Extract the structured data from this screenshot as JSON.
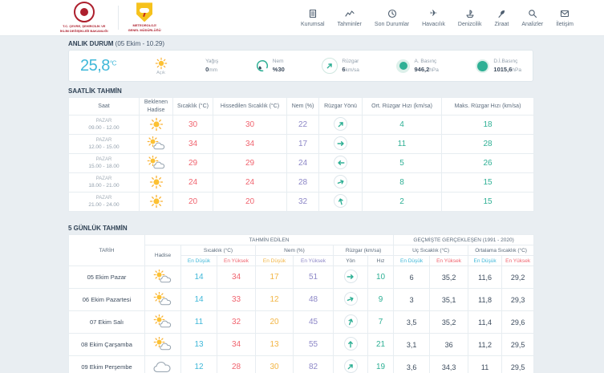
{
  "brand": {
    "ministry_caption_line1": "T.C. ÇEVRE, ŞEHİRCİLİK VE",
    "ministry_caption_line2": "İKLİM DEĞİŞİKLİĞİ BAKANLIĞI",
    "mgm_caption_line1": "METEOROLOJİ",
    "mgm_caption_line2": "GENEL MÜDÜRLÜĞÜ"
  },
  "nav": {
    "items": [
      {
        "label": "Kurumsal",
        "icon": "building"
      },
      {
        "label": "Tahminler",
        "icon": "chart"
      },
      {
        "label": "Son Durumlar",
        "icon": "clock"
      },
      {
        "label": "Havacılık",
        "icon": "plane"
      },
      {
        "label": "Denizcilik",
        "icon": "ship"
      },
      {
        "label": "Ziraat",
        "icon": "leaf"
      },
      {
        "label": "Analizler",
        "icon": "magnifier"
      },
      {
        "label": "İletişim",
        "icon": "mail"
      }
    ]
  },
  "current": {
    "section_title": "ANLIK DURUM",
    "section_time": "(05 Ekim - 10.29)",
    "temperature": "25,8",
    "temperature_unit": "°C",
    "condition": "Açık",
    "condition_icon": "sun",
    "precip_label": "Yağış",
    "precip_value": "0",
    "precip_unit": "mm",
    "humidity_label": "Nem",
    "humidity_value": "%30",
    "wind_label": "Rüzgar",
    "wind_value": "6",
    "wind_unit": "km/sa",
    "wind_dir": "NE",
    "pressure_label": "A. Basınç",
    "pressure_value": "946,2",
    "pressure_unit": "hPa",
    "sea_pressure_label": "D.İ.Basınç",
    "sea_pressure_value": "1015,6",
    "sea_pressure_unit": "hPa"
  },
  "hourly": {
    "section_title": "SAATLİK TAHMİN",
    "columns": [
      "Saat",
      "Beklenen Hadise",
      "Sıcaklık (°C)",
      "Hissedilen Sıcaklık (°C)",
      "Nem (%)",
      "Rüzgar Yönü",
      "Ort. Rüzgar Hızı (km/sa)",
      "Maks. Rüzgar Hızı (km/sa)"
    ],
    "rows": [
      {
        "day": "PAZAR",
        "time": "09.00 - 12.00",
        "icon": "sun",
        "temp": "30",
        "feels": "30",
        "humidity": "22",
        "dir": "NE",
        "avg_wind": "4",
        "max_wind": "18"
      },
      {
        "day": "PAZAR",
        "time": "12.00 - 15.00",
        "icon": "sun-cloud",
        "temp": "34",
        "feels": "34",
        "humidity": "17",
        "dir": "E",
        "avg_wind": "11",
        "max_wind": "28"
      },
      {
        "day": "PAZAR",
        "time": "15.00 - 18.00",
        "icon": "sun-cloud",
        "temp": "29",
        "feels": "29",
        "humidity": "24",
        "dir": "W",
        "avg_wind": "5",
        "max_wind": "26"
      },
      {
        "day": "PAZAR",
        "time": "18.00 - 21.00",
        "icon": "sun",
        "temp": "24",
        "feels": "24",
        "humidity": "28",
        "dir": "ENE",
        "avg_wind": "8",
        "max_wind": "15"
      },
      {
        "day": "PAZAR",
        "time": "21.00 - 24.00",
        "icon": "sun",
        "temp": "20",
        "feels": "20",
        "humidity": "32",
        "dir": "NNW",
        "avg_wind": "2",
        "max_wind": "15"
      }
    ]
  },
  "daily": {
    "section_title": "5 GÜNLÜK TAHMİN",
    "header": {
      "date": "TARİH",
      "predicted": "TAHMİN EDİLEN",
      "historical": "GEÇMİŞTE GERÇEKLEŞEN (1991 - 2020)",
      "hadise": "Hadise",
      "temp_group": "Sıcaklık (°C)",
      "hum_group": "Nem (%)",
      "wind_group": "Rüzgar (km/sa)",
      "extreme_group": "Uç Sıcaklık (°C)",
      "avg_group": "Ortalama Sıcaklık (°C)",
      "min": "En Düşük",
      "max": "En Yüksek",
      "dir": "Yön",
      "speed": "Hız"
    },
    "rows": [
      {
        "date": "05 Ekim Pazar",
        "icon": "sun-cloud",
        "tmin": "14",
        "tmax": "34",
        "hmin": "17",
        "hmax": "51",
        "dir": "E",
        "speed": "10",
        "ex_min": "6",
        "ex_max": "35,2",
        "avg_min": "11,6",
        "avg_max": "29,2"
      },
      {
        "date": "06 Ekim Pazartesi",
        "icon": "sun-cloud",
        "tmin": "14",
        "tmax": "33",
        "hmin": "12",
        "hmax": "48",
        "dir": "ENE",
        "speed": "9",
        "ex_min": "3",
        "ex_max": "35,1",
        "avg_min": "11,8",
        "avg_max": "29,3"
      },
      {
        "date": "07 Ekim Salı",
        "icon": "sun-cloud",
        "tmin": "11",
        "tmax": "32",
        "hmin": "20",
        "hmax": "45",
        "dir": "NNE",
        "speed": "7",
        "ex_min": "3,5",
        "ex_max": "35,2",
        "avg_min": "11,4",
        "avg_max": "29,6"
      },
      {
        "date": "08 Ekim Çarşamba",
        "icon": "sun-cloud",
        "tmin": "13",
        "tmax": "34",
        "hmin": "13",
        "hmax": "55",
        "dir": "N",
        "speed": "21",
        "ex_min": "3,1",
        "ex_max": "36",
        "avg_min": "11,2",
        "avg_max": "29,5"
      },
      {
        "date": "09 Ekim Perşembe",
        "icon": "cloud",
        "tmin": "12",
        "tmax": "28",
        "hmin": "30",
        "hmax": "82",
        "dir": "NE",
        "speed": "19",
        "ex_min": "3,6",
        "ex_max": "34,3",
        "avg_min": "11",
        "avg_max": "29,5"
      }
    ]
  },
  "colors": {
    "accent": "#2fb095",
    "temp_high": "#f0646f",
    "temp_low": "#40b8d9",
    "humidity": "#8d87c7",
    "humidity_low": "#f2b544",
    "brand_red": "#ad1f2d",
    "brand_yellow": "#f6c21c"
  }
}
